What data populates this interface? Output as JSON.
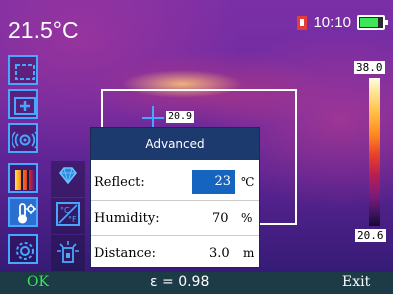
{
  "header": {
    "temperature": "21.5°C",
    "time": "10:10",
    "battery_level": 0.76
  },
  "scale": {
    "max": "38.0",
    "min": "20.6"
  },
  "crosshair": {
    "value": "20.9"
  },
  "panel": {
    "title": "Advanced",
    "rows": [
      {
        "label": "Reflect:",
        "value": "23",
        "unit": "℃"
      },
      {
        "label": "Humidity:",
        "value": "70",
        "unit": "%"
      },
      {
        "label": "Distance:",
        "value": "3.0",
        "unit": "m"
      }
    ]
  },
  "bottom": {
    "ok": "OK",
    "emissivity": "ε = 0.98",
    "exit": "Exit"
  },
  "colors": {
    "accent": "#49a6ff",
    "selected": "#2b6fd1",
    "panel_header": "#1d3a6e",
    "value_highlight": "#1565c0",
    "ok_green": "#3ee65a",
    "bottom_bar": "#1d3a47"
  },
  "icons": {
    "sidebar": [
      "area-measure-icon",
      "spot-measure-icon",
      "laser-icon",
      "palette-icon",
      "temperature-settings-icon",
      "settings-gear-icon"
    ],
    "submenu": [
      "emissivity-diamond-icon",
      "unit-conversion-icon",
      "distance-target-icon"
    ]
  }
}
